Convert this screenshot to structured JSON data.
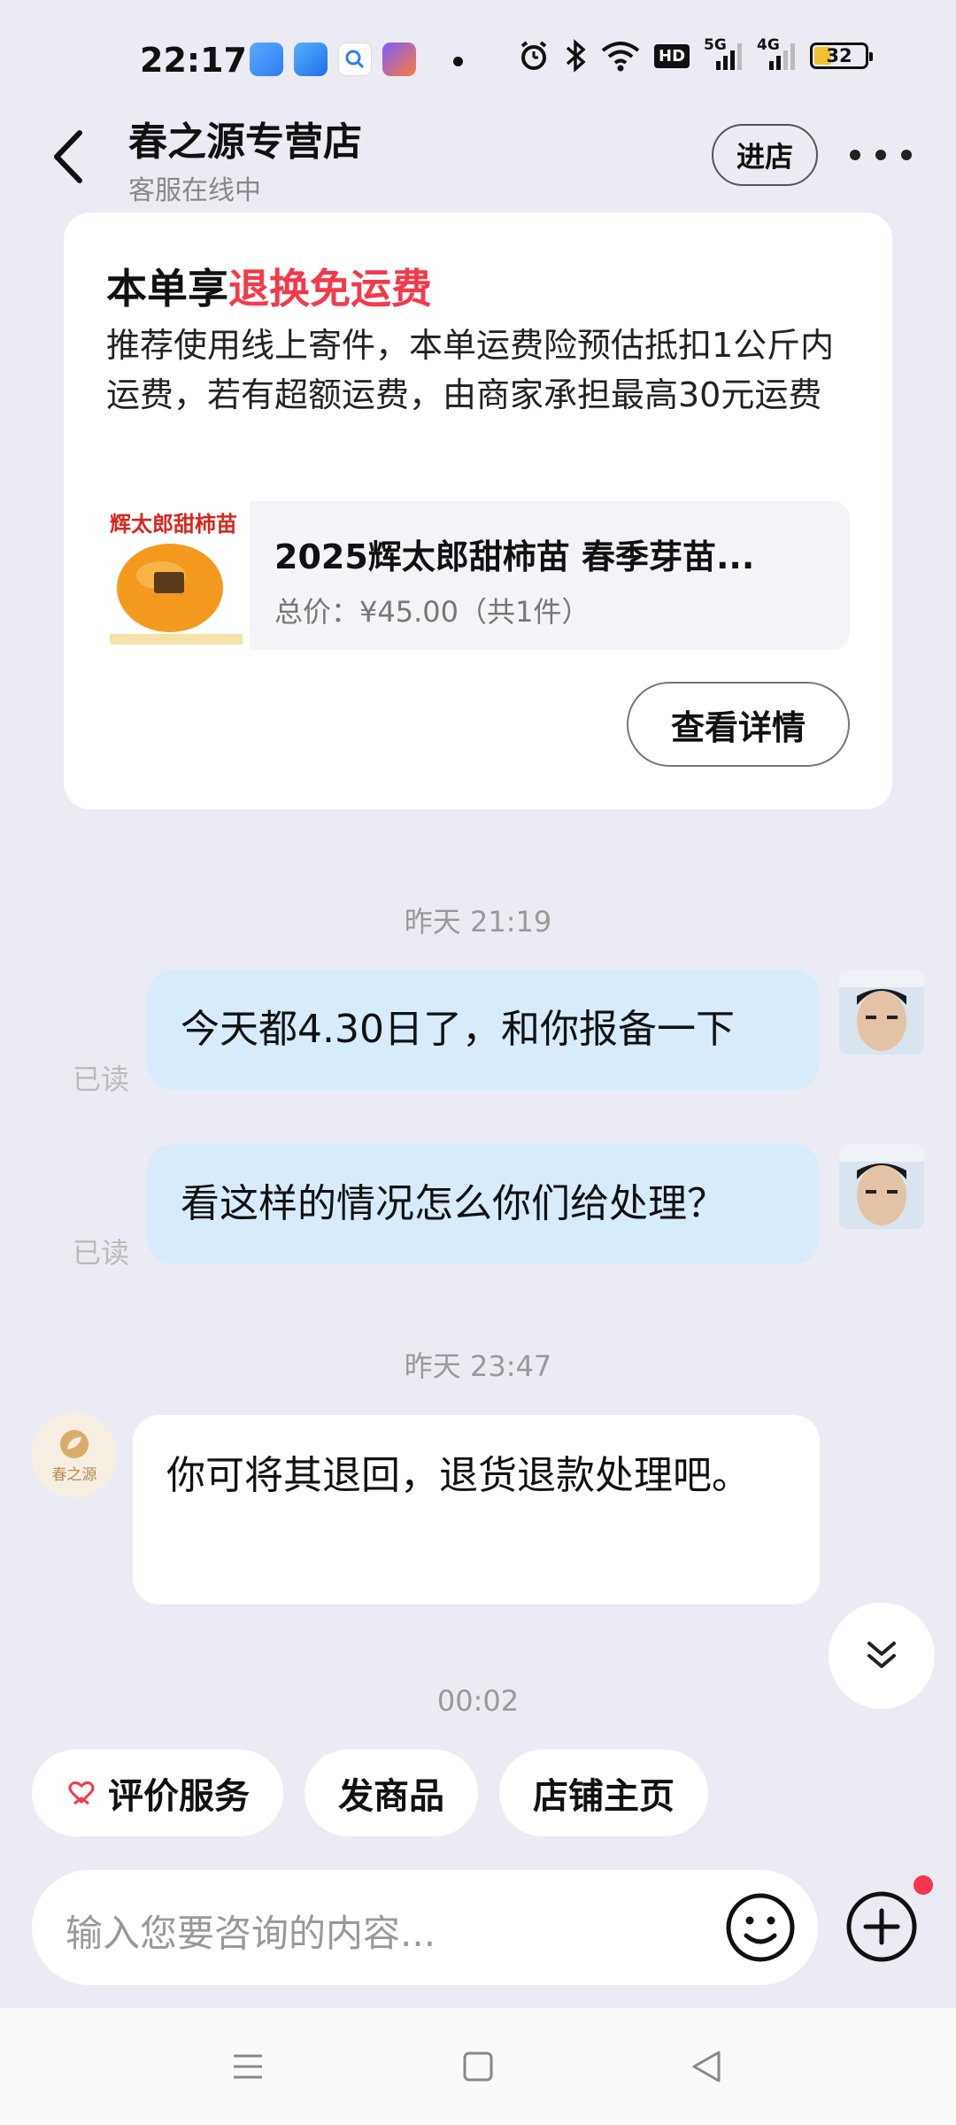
{
  "status_bar": {
    "time": "22:17",
    "battery": "32",
    "network_badge": "HD",
    "signal_5g": "5G",
    "signal_4g": "4G"
  },
  "header": {
    "title": "春之源专营店",
    "subtitle": "客服在线中",
    "enter_shop_label": "进店"
  },
  "order_card": {
    "headline_prefix": "本单享",
    "headline_highlight": "退换免运费",
    "description": "推荐使用线上寄件，本单运费险预估抵扣1公斤内运费，若有超额运费，由商家承担最高30元运费",
    "product": {
      "thumb_label": "辉太郎甜柿苗",
      "name": "2025辉太郎甜柿苗 春季芽苗...",
      "price": "总价：¥45.00（共1件）"
    },
    "detail_button": "查看详情"
  },
  "chat": {
    "time_1": "昨天 21:19",
    "msg_1": "今天都4.30日了，和你报备一下",
    "msg_2": "看这样的情况怎么你们给处理？",
    "read_label": "已读",
    "time_2": "昨天 23:47",
    "shop_avatar_text": "春之源",
    "reply": "你可将其退回，退货退款处理吧。",
    "time_3": "00:02"
  },
  "quick_actions": {
    "rate": "评价服务",
    "send_product": "发商品",
    "shop_home": "店铺主页"
  },
  "input": {
    "placeholder": "输入您要咨询的内容..."
  },
  "colors": {
    "accent_red": "#f23a4a",
    "my_bubble": "#d7ebfb",
    "background": "#ebebf3"
  }
}
